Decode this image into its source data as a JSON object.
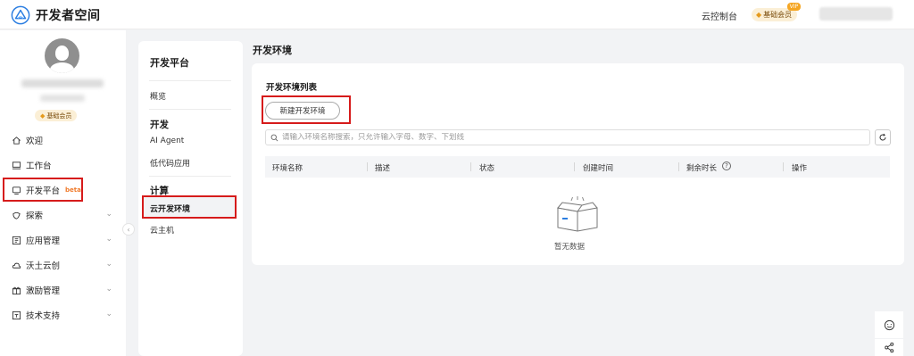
{
  "header": {
    "app_title": "开发者空间",
    "console_link": "云控制台",
    "member_badge": "基础会员",
    "member_vip": "VIP"
  },
  "sidebar": {
    "member_badge": "基础会员",
    "items": [
      {
        "label": "欢迎",
        "icon": "home-icon",
        "has_chevron": false
      },
      {
        "label": "工作台",
        "icon": "monitor-icon",
        "has_chevron": false
      },
      {
        "label": "开发平台",
        "icon": "dev-platform-icon",
        "badge": "beta",
        "has_chevron": false
      },
      {
        "label": "探索",
        "icon": "explore-icon",
        "has_chevron": true
      },
      {
        "label": "应用管理",
        "icon": "app-manage-icon",
        "has_chevron": true
      },
      {
        "label": "沃土云创",
        "icon": "cloud-icon",
        "has_chevron": true
      },
      {
        "label": "激励管理",
        "icon": "gift-icon",
        "has_chevron": true
      },
      {
        "label": "技术支持",
        "icon": "support-icon",
        "has_chevron": true
      }
    ]
  },
  "midnav": {
    "title": "开发平台",
    "overview": "概览",
    "section_dev": "开发",
    "ai_agent": "AI Agent",
    "lowcode": "低代码应用",
    "section_compute": "计算",
    "cloud_dev_env": "云开发环境",
    "cloud_host": "云主机"
  },
  "main": {
    "page_title": "开发环境",
    "panel_title": "开发环境列表",
    "new_button": "新建开发环境",
    "search_placeholder": "请输入环境名称搜索，只允许输入字母、数字、下划线",
    "columns": [
      "环境名称",
      "描述",
      "状态",
      "创建时间",
      "剩余时长",
      "操作"
    ],
    "empty_text": "暂无数据"
  },
  "colors": {
    "highlight": "#d61b1b",
    "member_bg": "#fbefd6",
    "beta": "#f07b2c"
  }
}
